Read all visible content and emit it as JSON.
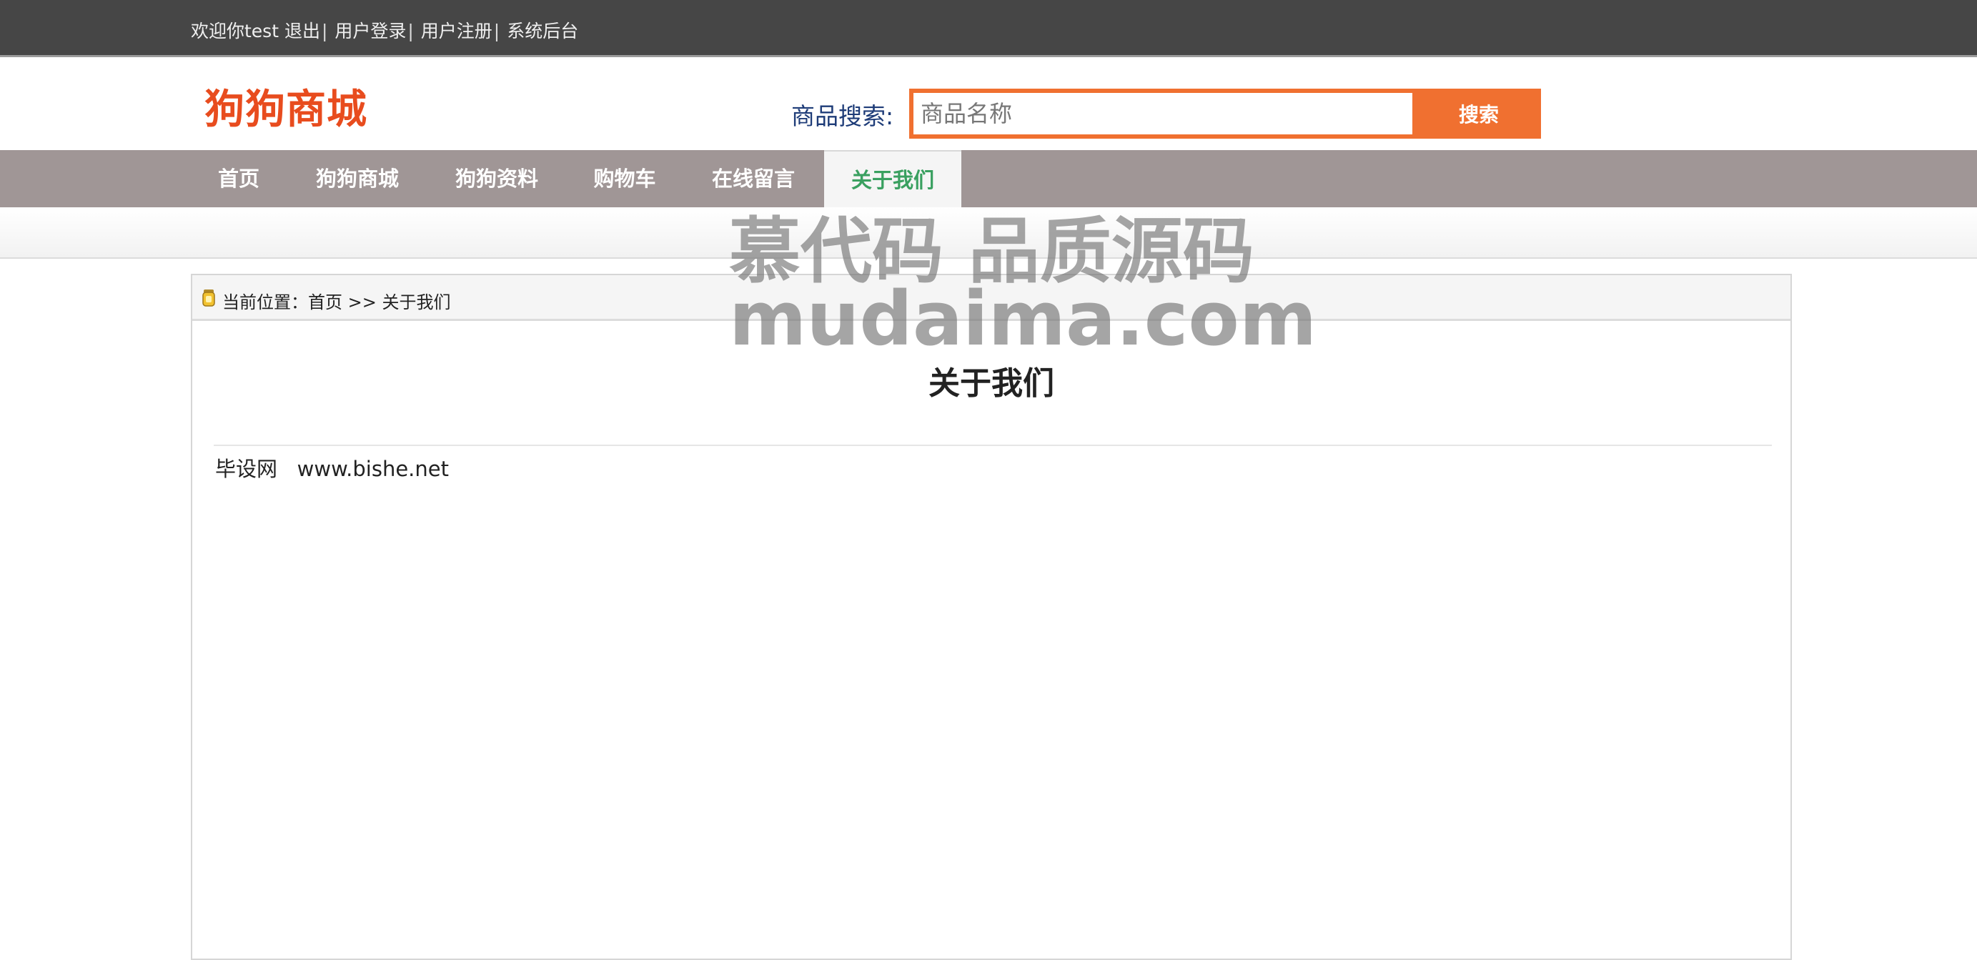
{
  "topbar": {
    "welcome": "欢迎你test",
    "logout": "退出",
    "login": "用户登录",
    "register": "用户注册",
    "admin": "系统后台",
    "separator": "|"
  },
  "header": {
    "logo": "狗狗商城",
    "search_label": "商品搜索:",
    "search_placeholder": "商品名称",
    "search_value": "",
    "search_button": "搜索"
  },
  "nav": {
    "items": [
      {
        "label": "首页",
        "active": false
      },
      {
        "label": "狗狗商城",
        "active": false
      },
      {
        "label": "狗狗资料",
        "active": false
      },
      {
        "label": "购物车",
        "active": false
      },
      {
        "label": "在线留言",
        "active": false
      },
      {
        "label": "关于我们",
        "active": true
      }
    ]
  },
  "breadcrumb": {
    "prefix": "当前位置：",
    "home": "首页",
    "arrow": ">>",
    "current": "关于我们"
  },
  "content": {
    "heading": "关于我们",
    "text": "毕设网   www.bishe.net"
  },
  "watermark": {
    "line1": "慕代码 品质源码",
    "line2": "mudaima.com"
  },
  "colors": {
    "accent": "#f07030",
    "logo": "#e84c1e",
    "nav_bg": "#a09696",
    "nav_active_text": "#3aa060",
    "topbar_bg": "#464646"
  }
}
